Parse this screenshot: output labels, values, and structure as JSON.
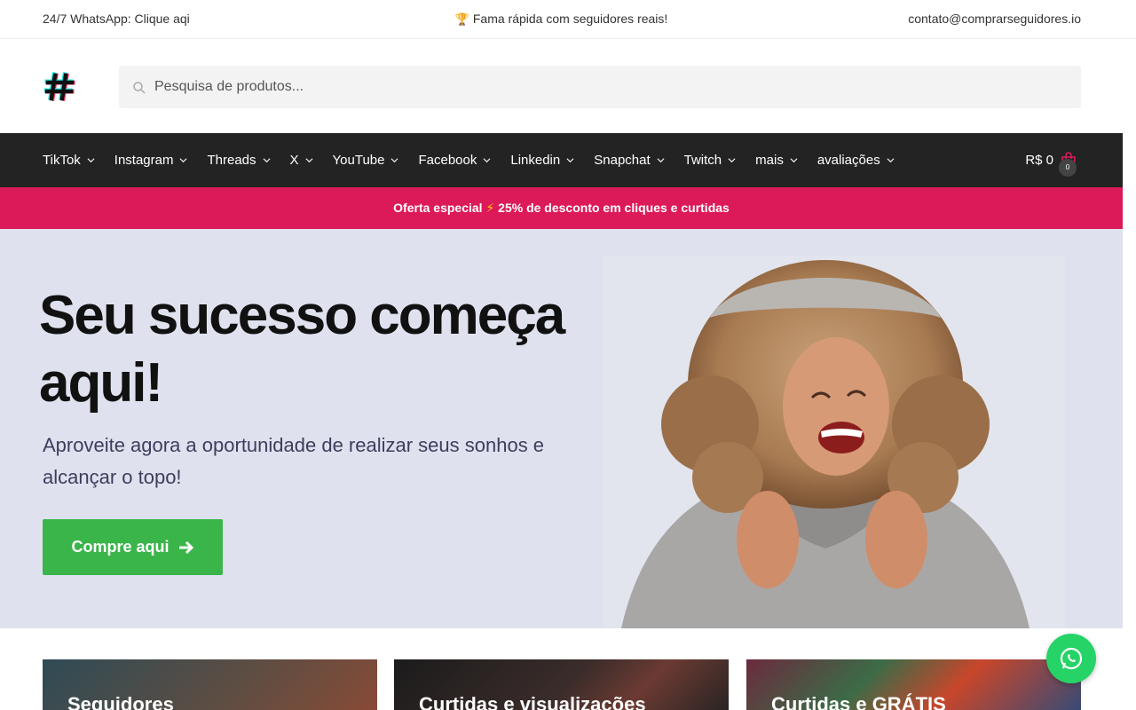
{
  "topbar": {
    "whatsapp_text": "24/7 WhatsApp: Clique aqi",
    "promo_text": "Fama rápida com seguidores reais!",
    "email": "contato@comprarseguidores.io"
  },
  "search": {
    "placeholder": "Pesquisa de produtos..."
  },
  "nav": {
    "items": [
      {
        "label": "TikTok"
      },
      {
        "label": "Instagram"
      },
      {
        "label": "Threads"
      },
      {
        "label": "X"
      },
      {
        "label": "YouTube"
      },
      {
        "label": "Facebook"
      },
      {
        "label": "Linkedin"
      },
      {
        "label": "Snapchat"
      },
      {
        "label": "Twitch"
      },
      {
        "label": "mais"
      },
      {
        "label": "avaliações"
      }
    ],
    "cart_total": "R$ 0",
    "cart_count": "0"
  },
  "promo_bar": {
    "prefix": "Oferta especial",
    "suffix": "25% de desconto em cliques e curtidas"
  },
  "hero": {
    "headline": "Seu sucesso começa aqui!",
    "subtext": "Aproveite agora a oportunidade de realizar seus sonhos e alcançar o topo!",
    "cta_label": "Compre aqui"
  },
  "cards": [
    {
      "title": "Seguidores"
    },
    {
      "title": "Curtidas e visualizações"
    },
    {
      "title": "Curtidas e GRÁTIS"
    }
  ],
  "colors": {
    "nav_bg": "#232323",
    "promo_bg": "#dc1a5a",
    "hero_bg": "#dfe2ee",
    "cta_bg": "#3ab54a",
    "whatsapp": "#25d366"
  }
}
